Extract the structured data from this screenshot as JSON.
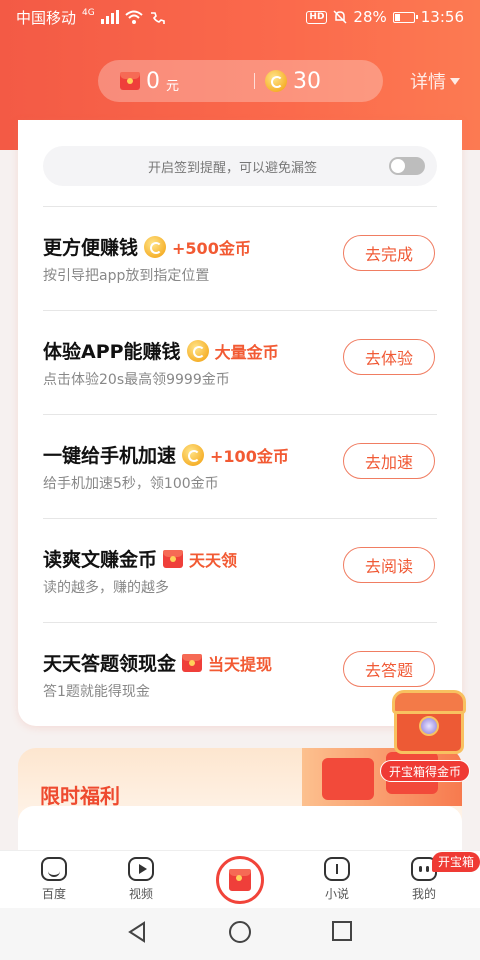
{
  "status_bar": {
    "carrier": "中国移动",
    "network": "4G",
    "battery": "28%",
    "time": "13:56",
    "hd": "HD"
  },
  "header": {
    "cash_value": "0",
    "cash_unit": "元",
    "coins_value": "30",
    "detail_label": "详情"
  },
  "reminder": {
    "text": "开启签到提醒，可以避免漏签",
    "enabled": false
  },
  "tasks": [
    {
      "name": "更方便赚钱",
      "reward_icon": "coin-icon",
      "reward": "+500金币",
      "desc": "按引导把app放到指定位置",
      "button": "去完成"
    },
    {
      "name": "体验APP能赚钱",
      "reward_icon": "coin-icon",
      "reward": "大量金币",
      "desc": "点击体验20s最高领9999金币",
      "button": "去体验"
    },
    {
      "name": "一键给手机加速",
      "reward_icon": "coin-icon",
      "reward": "+100金币",
      "desc": "给手机加速5秒，领100金币",
      "button": "去加速"
    },
    {
      "name": "读爽文赚金币",
      "reward_icon": "red-envelope-icon",
      "reward": "天天领",
      "desc": "读的越多，赚的越多",
      "button": "去阅读"
    },
    {
      "name": "天天答题领现金",
      "reward_icon": "red-envelope-icon",
      "reward": "当天提现",
      "desc": "答1题就能得现金",
      "button": "去答题"
    }
  ],
  "treasure": {
    "label": "开宝箱得金币"
  },
  "welfare": {
    "title": "限时福利"
  },
  "bottom_nav": {
    "items": [
      "百度",
      "视频",
      "小说",
      "我的"
    ],
    "badge": "开宝箱"
  },
  "colors": {
    "accent": "#f25a33",
    "header_bg": "#f86048"
  }
}
